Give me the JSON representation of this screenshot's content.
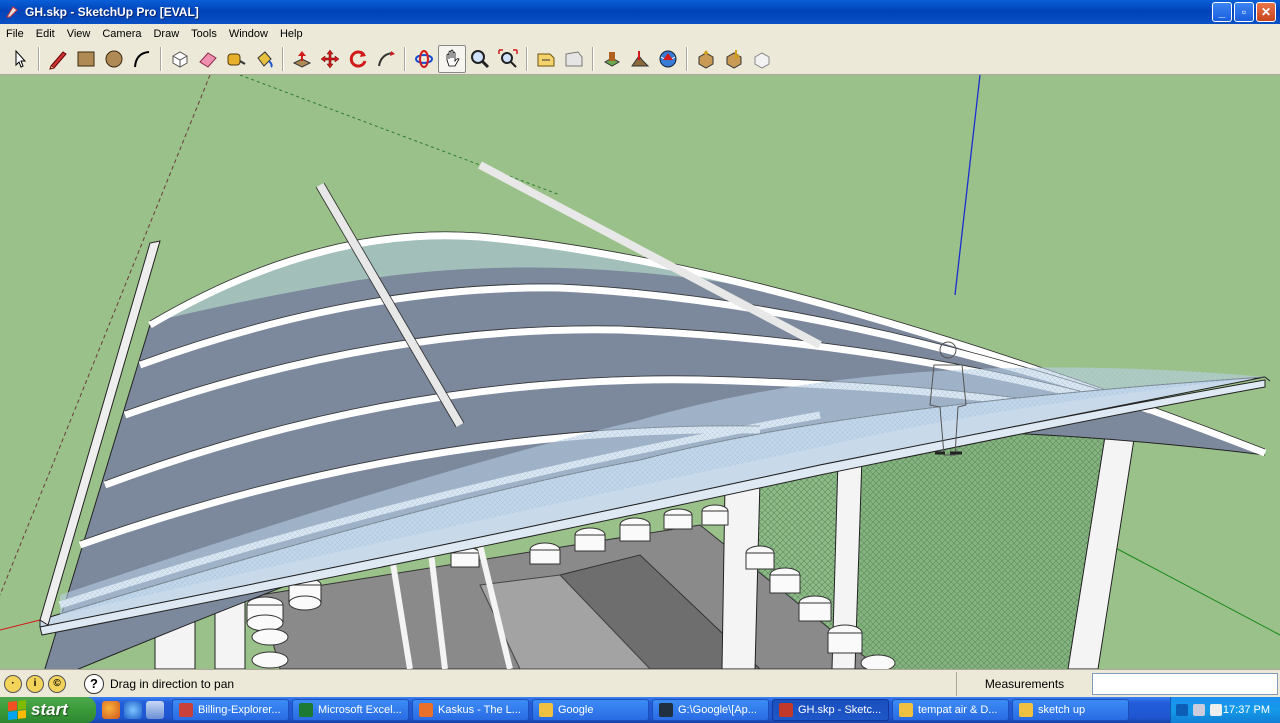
{
  "window": {
    "title": "GH.skp - SketchUp Pro [EVAL]",
    "minimize_label": "_",
    "maximize_label": "▫",
    "close_label": "✕"
  },
  "menu": [
    "File",
    "Edit",
    "View",
    "Camera",
    "Draw",
    "Tools",
    "Window",
    "Help"
  ],
  "toolbar": {
    "tools": [
      "select-icon",
      "pencil-icon",
      "rectangle-icon",
      "circle-icon",
      "arc-icon",
      "make-component-icon",
      "eraser-icon",
      "tape-measure-icon",
      "paint-bucket-icon",
      "push-pull-icon",
      "move-icon",
      "rotate-icon",
      "follow-me-icon",
      "orbit-icon",
      "pan-icon",
      "zoom-icon",
      "zoom-extents-icon",
      "previous-view-icon",
      "next-view-icon",
      "add-location-icon",
      "toggle-terrain-icon",
      "get-models-icon",
      "share-model-icon",
      "get-components-icon",
      "share-component-icon"
    ],
    "active_tool": "pan-icon"
  },
  "viewport": {
    "colors": {
      "background": "#9bc18a",
      "roof_panel": "#7d8a9e",
      "roof_edge": "#ffffff",
      "fascia": "#c8d9ea",
      "red_axis": "#d11a1a",
      "green_axis": "#1a8a1a",
      "blue_axis": "#1a2fd1"
    }
  },
  "statusbar": {
    "hint": "Drag in direction to pan",
    "help_label": "?",
    "measurements_label": "Measurements",
    "measurements_value": ""
  },
  "taskbar": {
    "start_label": "start",
    "items": [
      {
        "label": "Billing-Explorer...",
        "color": "#c8413b"
      },
      {
        "label": "Microsoft Excel...",
        "color": "#1d7a34"
      },
      {
        "label": "Kaskus - The L...",
        "color": "#e8702a"
      },
      {
        "label": "Google",
        "color": "#f0c040"
      },
      {
        "label": "G:\\Google\\[Ap...",
        "color": "#203040"
      },
      {
        "label": "GH.skp - Sketc...",
        "color": "#c0392b"
      },
      {
        "label": "tempat air & D...",
        "color": "#f0c040"
      },
      {
        "label": "sketch up",
        "color": "#f0c040"
      }
    ],
    "active_index": 5,
    "clock": "17:37 PM"
  }
}
